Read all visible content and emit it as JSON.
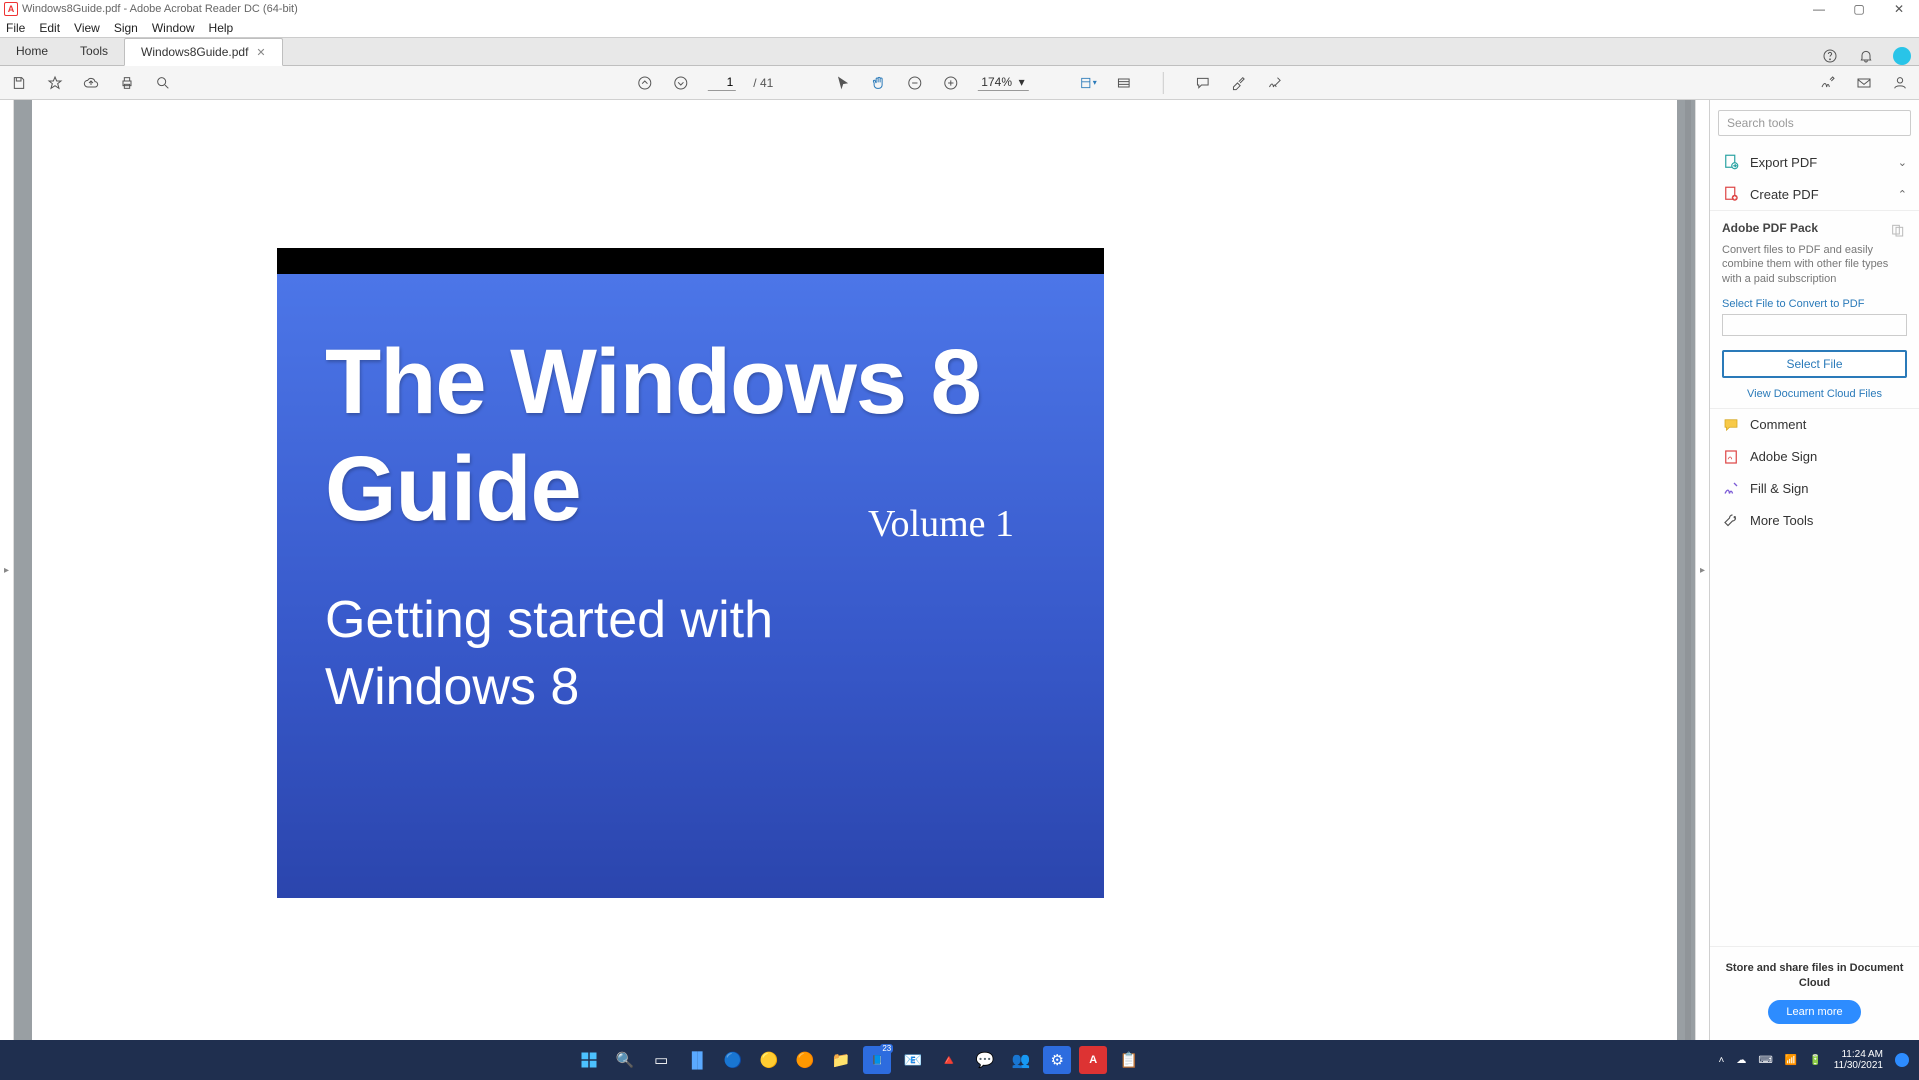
{
  "window": {
    "title": "Windows8Guide.pdf - Adobe Acrobat Reader DC (64-bit)"
  },
  "menu": {
    "file": "File",
    "edit": "Edit",
    "view": "View",
    "sign": "Sign",
    "window": "Window",
    "help": "Help"
  },
  "tabs": {
    "home": "Home",
    "tools": "Tools",
    "doc": "Windows8Guide.pdf"
  },
  "toolbar": {
    "page": "1",
    "page_total": "/ 41",
    "zoom": "174%"
  },
  "document": {
    "title_l1": "The Windows 8",
    "title_l2": "Guide",
    "volume": "Volume 1",
    "subtitle_l1": "Getting started with",
    "subtitle_l2": "Windows 8"
  },
  "rhs": {
    "search_ph": "Search tools",
    "export": "Export PDF",
    "create": "Create PDF",
    "pack_title": "Adobe PDF Pack",
    "pack_desc": "Convert files to PDF and easily combine them with other file types with a paid subscription",
    "select_label": "Select File to Convert to PDF",
    "select_btn": "Select File",
    "dc_link": "View Document Cloud Files",
    "comment": "Comment",
    "adobesign": "Adobe Sign",
    "fillsign": "Fill & Sign",
    "more": "More Tools",
    "promo_text": "Store and share files in Document Cloud",
    "promo_btn": "Learn more"
  },
  "tray": {
    "time": "11:24 AM",
    "date": "11/30/2021"
  }
}
